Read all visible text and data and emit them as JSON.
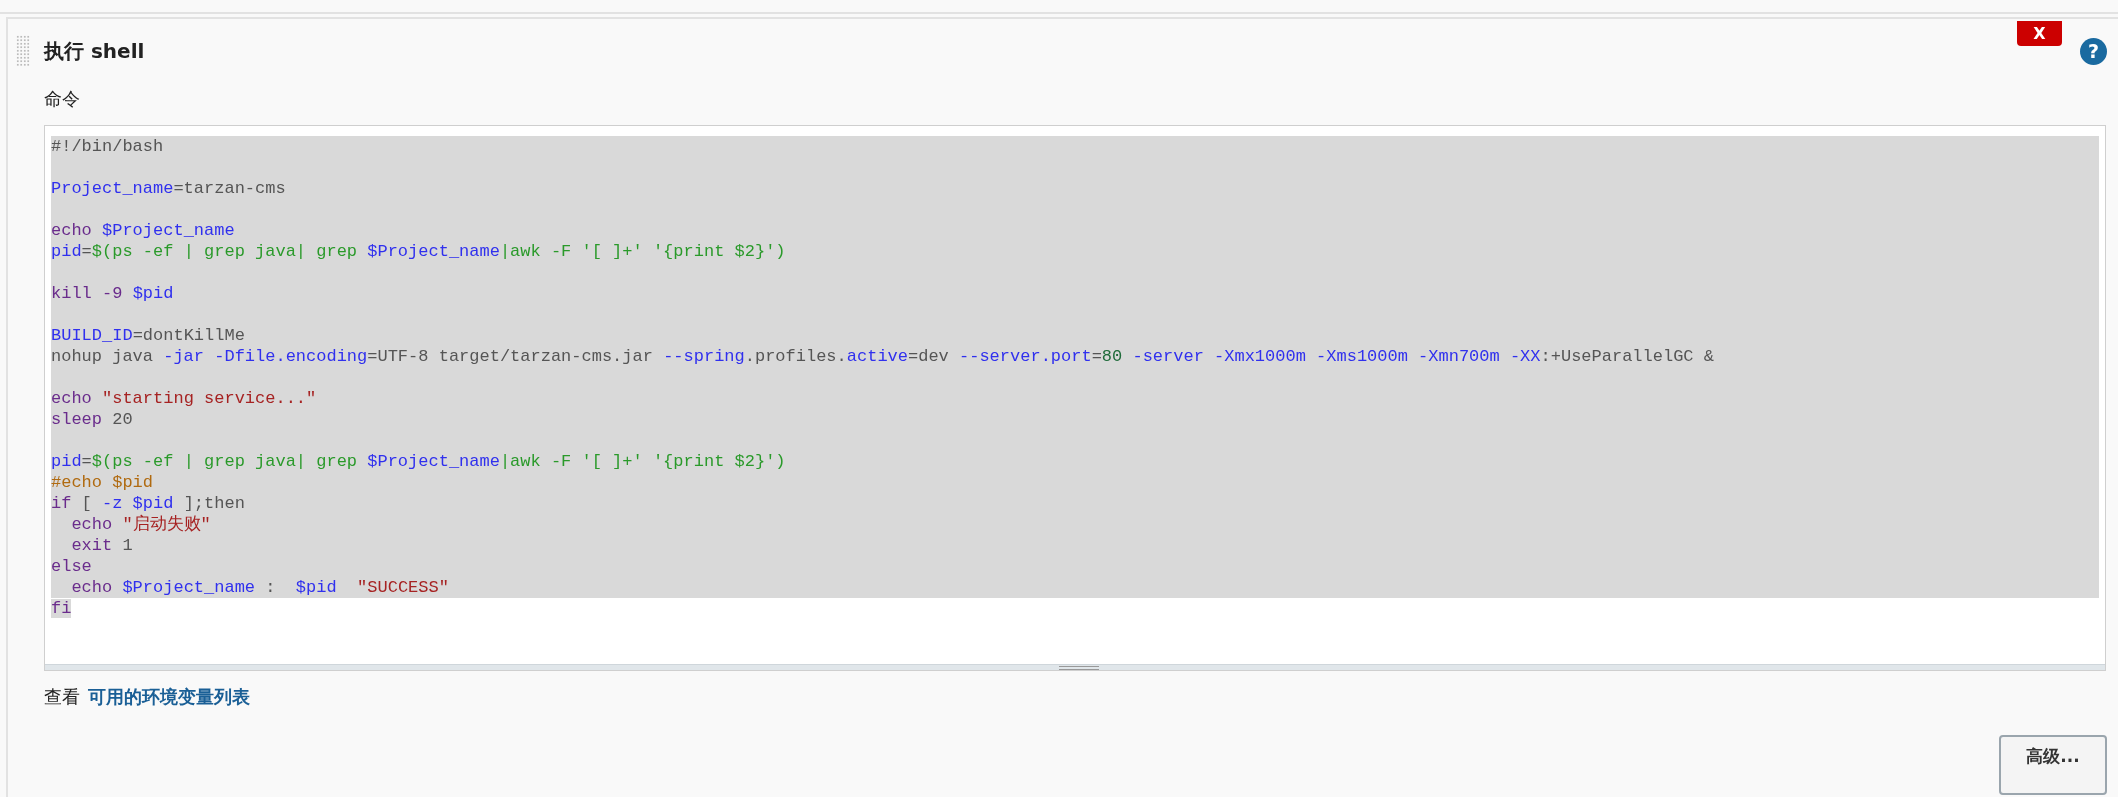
{
  "step": {
    "title": "执行 shell",
    "delete_label": "X",
    "help_label": "?"
  },
  "command": {
    "label": "命令",
    "lines": [
      {
        "selected": true,
        "segments": [
          {
            "kind": "text",
            "text": "#!/bin/bash"
          }
        ]
      },
      {
        "selected": true
      },
      {
        "selected": true,
        "segments": [
          {
            "kind": "var",
            "text": "Project_name"
          },
          {
            "kind": "text",
            "text": "=tarzan-cms"
          }
        ]
      },
      {
        "selected": true
      },
      {
        "selected": true,
        "segments": [
          {
            "kind": "keyword",
            "text": "echo "
          },
          {
            "kind": "var",
            "text": "$Project_name"
          }
        ]
      },
      {
        "selected": true,
        "segments": [
          {
            "kind": "var",
            "text": "pid"
          },
          {
            "kind": "text",
            "text": "="
          },
          {
            "kind": "sub",
            "text": "$(ps -ef | grep java| grep "
          },
          {
            "kind": "var",
            "text": "$Project_name"
          },
          {
            "kind": "sub",
            "text": "|awk -F '[ ]+' '{print $2}')"
          }
        ]
      },
      {
        "selected": true
      },
      {
        "selected": true,
        "segments": [
          {
            "kind": "keyword",
            "text": "kill -9 "
          },
          {
            "kind": "var",
            "text": "$pid"
          }
        ]
      },
      {
        "selected": true
      },
      {
        "selected": true,
        "segments": [
          {
            "kind": "var",
            "text": "BUILD_ID"
          },
          {
            "kind": "text",
            "text": "=dontKillMe"
          }
        ]
      },
      {
        "selected": true,
        "segments": [
          {
            "kind": "text",
            "text": "nohup java "
          },
          {
            "kind": "var",
            "text": "-jar -Dfile.encoding"
          },
          {
            "kind": "text",
            "text": "=UTF-8 target/tarzan-cms.jar "
          },
          {
            "kind": "var",
            "text": "--spring"
          },
          {
            "kind": "text",
            "text": ".profiles."
          },
          {
            "kind": "var",
            "text": "active"
          },
          {
            "kind": "text",
            "text": "=dev "
          },
          {
            "kind": "var",
            "text": "--server.port"
          },
          {
            "kind": "text",
            "text": "="
          },
          {
            "kind": "number",
            "text": "80"
          },
          {
            "kind": "var",
            "text": " -server -Xmx1000m -Xms1000m -Xmn700m -XX"
          },
          {
            "kind": "text",
            "text": ":+UseParallelGC &"
          }
        ]
      },
      {
        "selected": true
      },
      {
        "selected": true,
        "segments": [
          {
            "kind": "keyword",
            "text": "echo "
          },
          {
            "kind": "string",
            "text": "\"starting service...\""
          }
        ]
      },
      {
        "selected": true,
        "segments": [
          {
            "kind": "keyword",
            "text": "sleep "
          },
          {
            "kind": "text",
            "text": "20"
          }
        ]
      },
      {
        "selected": true
      },
      {
        "selected": true,
        "segments": [
          {
            "kind": "var",
            "text": "pid"
          },
          {
            "kind": "text",
            "text": "="
          },
          {
            "kind": "sub",
            "text": "$(ps -ef | grep java| grep "
          },
          {
            "kind": "var",
            "text": "$Project_name"
          },
          {
            "kind": "sub",
            "text": "|awk -F '[ ]+' '{print $2}')"
          }
        ]
      },
      {
        "selected": true,
        "segments": [
          {
            "kind": "comment",
            "text": "#echo $pid"
          }
        ]
      },
      {
        "selected": true,
        "segments": [
          {
            "kind": "keyword",
            "text": "if "
          },
          {
            "kind": "text",
            "text": "[ "
          },
          {
            "kind": "var",
            "text": "-z $pid"
          },
          {
            "kind": "text",
            "text": " ];then"
          }
        ]
      },
      {
        "selected": true,
        "segments": [
          {
            "kind": "keyword",
            "text": "  echo "
          },
          {
            "kind": "string",
            "text": "\"启动失败\""
          }
        ]
      },
      {
        "selected": true,
        "segments": [
          {
            "kind": "keyword",
            "text": "  exit "
          },
          {
            "kind": "text",
            "text": "1"
          }
        ]
      },
      {
        "selected": true,
        "segments": [
          {
            "kind": "keyword",
            "text": "else"
          }
        ]
      },
      {
        "selected": true,
        "segments": [
          {
            "kind": "keyword",
            "text": "  echo "
          },
          {
            "kind": "var",
            "text": "$Project_name"
          },
          {
            "kind": "text",
            "text": " :  "
          },
          {
            "kind": "var",
            "text": "$pid"
          },
          {
            "kind": "string",
            "text": "  \"SUCCESS\""
          }
        ]
      },
      {
        "selected": true,
        "segments": [
          {
            "kind": "keyword",
            "text": "fi"
          }
        ]
      }
    ]
  },
  "env_hint": {
    "prefix": "查看",
    "link": "可用的环境变量列表"
  },
  "advanced_button": "高级..."
}
